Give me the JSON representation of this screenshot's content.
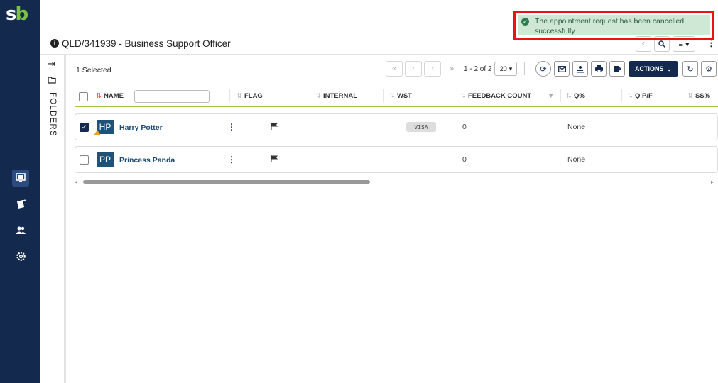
{
  "app": {
    "logo_s": "s",
    "logo_b": "b"
  },
  "header": {
    "title": "QLD/341939 - Business Support Officer",
    "info_icon": "i"
  },
  "folders": {
    "label": "FOLDERS"
  },
  "toolbar": {
    "selected_text": "1 Selected",
    "pagination_text": "1 - 2 of 2",
    "page_size": "20",
    "actions_label": "ACTIONS"
  },
  "columns": {
    "name": "NAME",
    "flag": "FLAG",
    "internal": "INTERNAL",
    "wst": "WST",
    "feedback_count": "FEEDBACK COUNT",
    "q_pct": "Q%",
    "q_pf": "Q P/F",
    "ss_pct": "SS%"
  },
  "rows": [
    {
      "initials": "HP",
      "name": "Harry Potter",
      "wst": "VISA",
      "feedback_count": "0",
      "q_pct": "None",
      "selected": true
    },
    {
      "initials": "PP",
      "name": "Princess Panda",
      "wst": "",
      "feedback_count": "0",
      "q_pct": "None",
      "selected": false
    }
  ],
  "toast": {
    "message": "The appointment request has been cancelled successfully"
  },
  "colors": {
    "navy": "#14294e",
    "accent_green": "#9bc83c",
    "toast_bg": "#cfe8d6",
    "highlight": "#e11111"
  }
}
